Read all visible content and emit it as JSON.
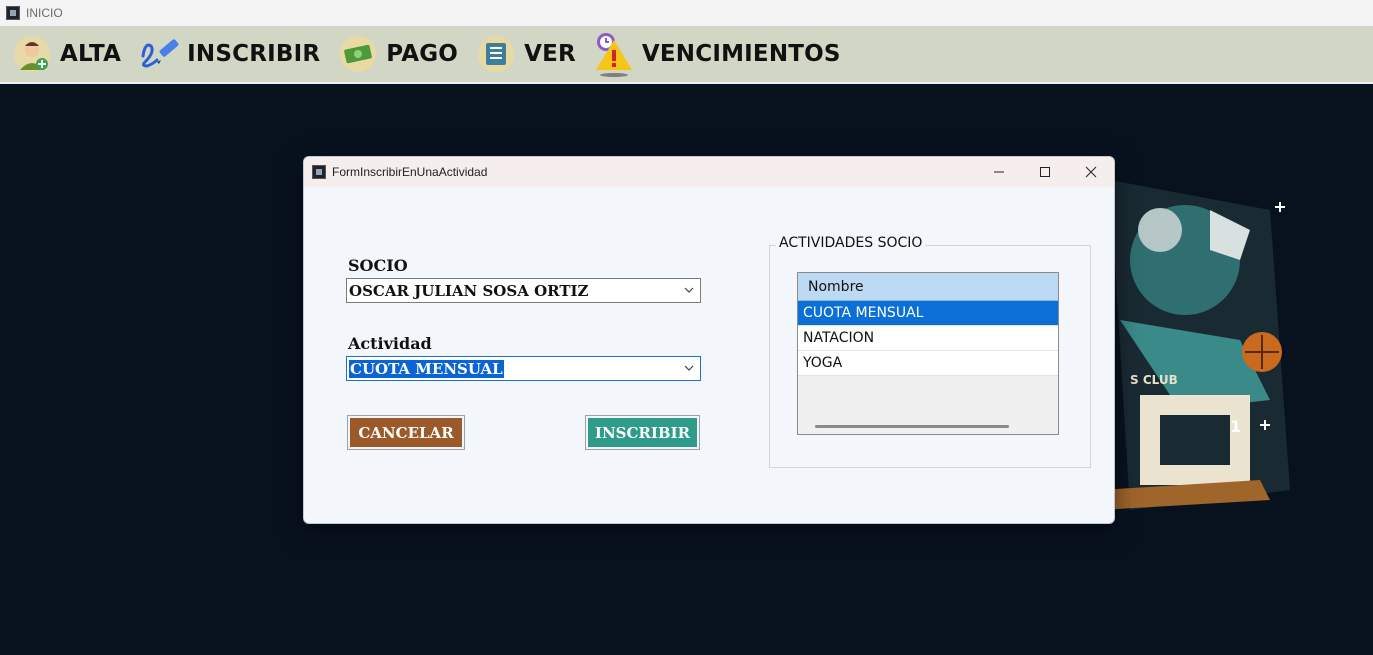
{
  "app": {
    "title": "INICIO"
  },
  "menu": {
    "items": [
      {
        "label": "ALTA",
        "icon": "user-add-icon"
      },
      {
        "label": "INSCRIBIR",
        "icon": "signature-pen-icon"
      },
      {
        "label": "PAGO",
        "icon": "money-icon"
      },
      {
        "label": "VER",
        "icon": "list-icon"
      },
      {
        "label": "VENCIMIENTOS",
        "icon": "warning-clock-icon"
      }
    ]
  },
  "background_art": {
    "text_club": "S CLUB",
    "text_number": "1"
  },
  "dialog": {
    "title": "FormInscribirEnUnaActividad",
    "socio_label": "SOCIO",
    "socio_value": "OSCAR JULIAN SOSA ORTIZ",
    "actividad_label": "Actividad",
    "actividad_value": "CUOTA MENSUAL",
    "cancel_label": "CANCELAR",
    "inscribir_label": "INSCRIBIR",
    "group_title": "ACTIVIDADES SOCIO",
    "grid": {
      "header": "Nombre",
      "rows": [
        "CUOTA MENSUAL",
        "NATACION",
        "YOGA"
      ],
      "selected_row": 0
    }
  },
  "colors": {
    "menubar": "#d2d6c4",
    "desktop": "#08121f",
    "cancel_button": "#9c5a2a",
    "inscribir_button": "#2f9b8b",
    "selection": "#0a6fd6",
    "grid_header": "#bcdaf3"
  }
}
